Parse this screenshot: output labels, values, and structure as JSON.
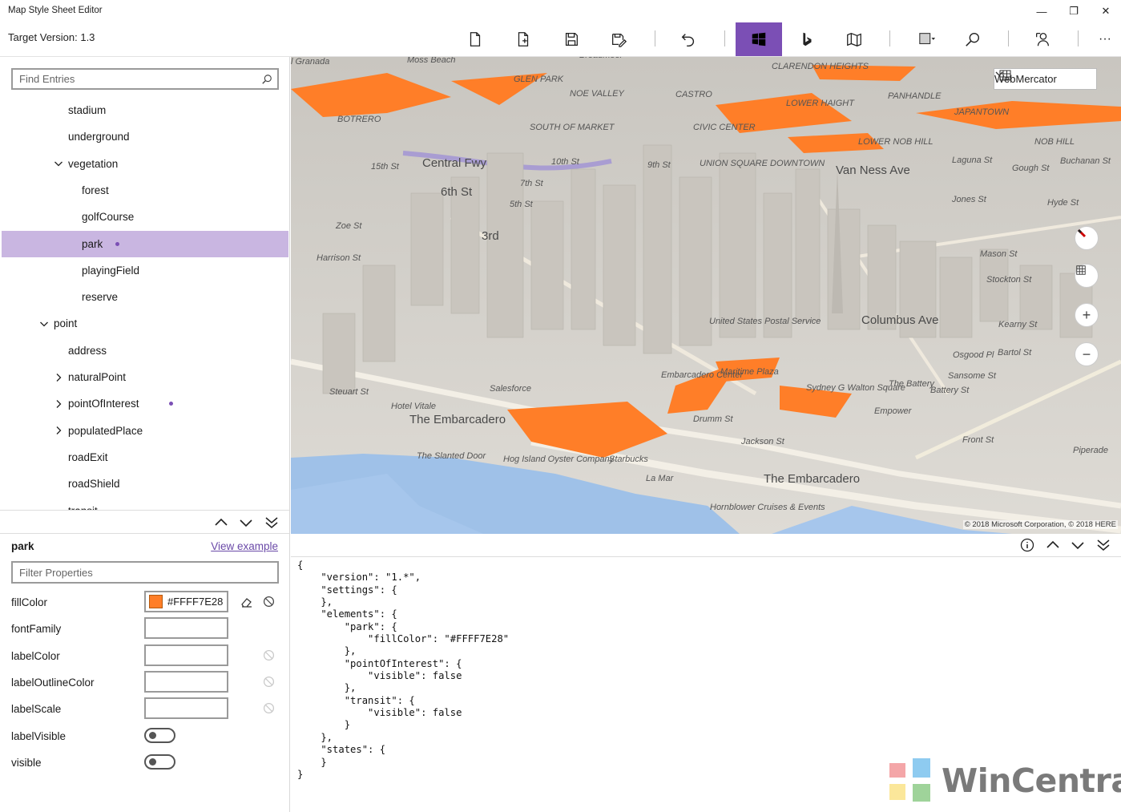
{
  "window": {
    "title": "Map Style Sheet Editor",
    "minimize": "—",
    "restore": "❐",
    "close": "✕"
  },
  "toolbar": {
    "target_version_label": "Target Version:",
    "target_version_value": "1.3",
    "more": "···"
  },
  "search": {
    "placeholder": "Find Entries"
  },
  "tree": [
    {
      "label": "stadium",
      "indent": 2,
      "expander": "none",
      "dot": false,
      "selected": false
    },
    {
      "label": "underground",
      "indent": 2,
      "expander": "none",
      "dot": false,
      "selected": false
    },
    {
      "label": "vegetation",
      "indent": 2,
      "expander": "expanded",
      "dot": false,
      "selected": false
    },
    {
      "label": "forest",
      "indent": 3,
      "expander": "none",
      "dot": false,
      "selected": false
    },
    {
      "label": "golfCourse",
      "indent": 3,
      "expander": "none",
      "dot": false,
      "selected": false
    },
    {
      "label": "park",
      "indent": 3,
      "expander": "none",
      "dot": true,
      "selected": true
    },
    {
      "label": "playingField",
      "indent": 3,
      "expander": "none",
      "dot": false,
      "selected": false
    },
    {
      "label": "reserve",
      "indent": 3,
      "expander": "none",
      "dot": false,
      "selected": false
    },
    {
      "label": "point",
      "indent": 1,
      "expander": "expanded",
      "dot": false,
      "selected": false
    },
    {
      "label": "address",
      "indent": 2,
      "expander": "none",
      "dot": false,
      "selected": false
    },
    {
      "label": "naturalPoint",
      "indent": 2,
      "expander": "collapsed",
      "dot": false,
      "selected": false
    },
    {
      "label": "pointOfInterest",
      "indent": 2,
      "expander": "collapsed",
      "dot": true,
      "selected": false
    },
    {
      "label": "populatedPlace",
      "indent": 2,
      "expander": "collapsed",
      "dot": false,
      "selected": false
    },
    {
      "label": "roadExit",
      "indent": 2,
      "expander": "none",
      "dot": false,
      "selected": false
    },
    {
      "label": "roadShield",
      "indent": 2,
      "expander": "none",
      "dot": false,
      "selected": false
    },
    {
      "label": "transit",
      "indent": 2,
      "expander": "none",
      "dot": false,
      "selected": false
    }
  ],
  "properties": {
    "title": "park",
    "view_example": "View example",
    "filter_placeholder": "Filter Properties",
    "rows": [
      {
        "name": "fillColor",
        "type": "color",
        "value": "#FFFF7E28",
        "swatch": "#ff7e28",
        "eraser": true
      },
      {
        "name": "fontFamily",
        "type": "text",
        "value": "",
        "reset": false
      },
      {
        "name": "labelColor",
        "type": "text",
        "value": "",
        "reset": true
      },
      {
        "name": "labelOutlineColor",
        "type": "text",
        "value": "",
        "reset": true
      },
      {
        "name": "labelScale",
        "type": "text",
        "value": "",
        "reset": true
      },
      {
        "name": "labelVisible",
        "type": "toggle",
        "value": "off"
      },
      {
        "name": "visible",
        "type": "toggle",
        "value": "off"
      }
    ]
  },
  "map": {
    "projection": "WebMercator",
    "copyright": "© 2018 Microsoft Corporation, © 2018 HERE",
    "park_color": "#ff7e28",
    "labels": [
      "l Granada",
      "Moss Beach",
      "Broadmoor",
      "GLEN PARK",
      "NOE VALLEY",
      "CASTRO",
      "CLARENDON HEIGHTS",
      "PANHANDLE",
      "LOWER HAIGHT",
      "JAPANTOWN",
      "BOTRERO",
      "SOUTH OF MARKET",
      "CIVIC CENTER",
      "LOWER NOB HILL",
      "NOB HILL",
      "Central Fwy",
      "15th St",
      "10th St",
      "9th St",
      "UNION SQUARE",
      "DOWNTOWN",
      "Van Ness Ave",
      "Laguna St",
      "Gough St",
      "Buchanan St",
      "6th St",
      "7th St",
      "5th St",
      "Jones St",
      "Hyde St",
      "Zoe St",
      "3rd",
      "Harrison St",
      "Mason St",
      "Columbus Ave",
      "Stockton St",
      "Sansome St",
      "Battery St",
      "Front St",
      "Steuart St",
      "The Embarcadero",
      "Hotel Vitale",
      "Salesforce",
      "Embarcadero Center",
      "Maritime Plaza",
      "Sydney G Walton Square",
      "Drumm St",
      "Jackson St",
      "The Embarcadero",
      "Hornblower Cruises & Events",
      "La Mar",
      "Starbucks",
      "Hog Island Oyster Company",
      "The Slanted Door",
      "Piperade",
      "United States Postal Service",
      "Kearny St",
      "Bartol St",
      "Osgood Pl",
      "Empower",
      "The Battery"
    ]
  },
  "json_text": "{\n    \"version\": \"1.*\",\n    \"settings\": {\n    },\n    \"elements\": {\n        \"park\": {\n            \"fillColor\": \"#FFFF7E28\"\n        },\n        \"pointOfInterest\": {\n            \"visible\": false\n        },\n        \"transit\": {\n            \"visible\": false\n        }\n    },\n    \"states\": {\n    }\n}",
  "watermark": {
    "text": "WinCentral"
  }
}
